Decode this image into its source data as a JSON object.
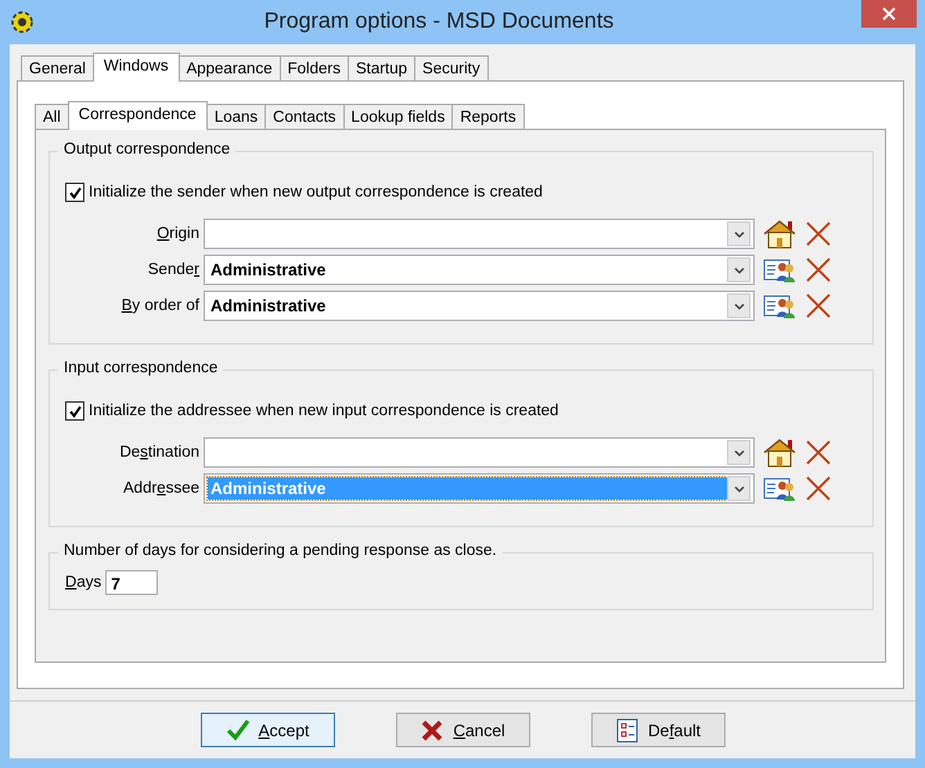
{
  "window": {
    "title": "Program options - MSD Documents"
  },
  "tabs": [
    {
      "label": "General",
      "selected": false
    },
    {
      "label": "Windows",
      "selected": true
    },
    {
      "label": "Appearance",
      "selected": false
    },
    {
      "label": "Folders",
      "selected": false
    },
    {
      "label": "Startup",
      "selected": false
    },
    {
      "label": "Security",
      "selected": false
    }
  ],
  "subtabs": [
    {
      "label": "All",
      "selected": false
    },
    {
      "label": "Correspondence",
      "selected": true
    },
    {
      "label": "Loans",
      "selected": false
    },
    {
      "label": "Contacts",
      "selected": false
    },
    {
      "label": "Lookup fields",
      "selected": false
    },
    {
      "label": "Reports",
      "selected": false
    }
  ],
  "groups": [
    {
      "title": "Output correspondence",
      "checkbox": {
        "label": "Initialize the sender when new output correspondence is created",
        "checked": true
      },
      "fields": [
        {
          "label": {
            "key": "O",
            "post": "rigin"
          },
          "kind": "house",
          "selected": false
        },
        {
          "label": {
            "pre": "Sende",
            "key": "r"
          },
          "value": "Administrative",
          "kind": "people",
          "selected": false
        },
        {
          "label": {
            "key": "B",
            "post": "y order of"
          },
          "value": "Administrative",
          "kind": "people",
          "selected": false
        }
      ]
    },
    {
      "title": "Input correspondence",
      "checkbox": {
        "label": "Initialize the addressee when new input correspondence is created",
        "checked": true
      },
      "fields": [
        {
          "label": {
            "pre": "De",
            "key": "s",
            "post": "tination"
          },
          "kind": "house",
          "selected": false
        },
        {
          "label": {
            "pre": "Addr",
            "key": "e",
            "post": "ssee"
          },
          "value": "Administrative",
          "kind": "people",
          "selected": true
        }
      ]
    }
  ],
  "days": {
    "title": "Number of days for considering a pending response as close.",
    "label": {
      "key": "D",
      "post": "ays"
    },
    "value": "7"
  },
  "buttons": [
    {
      "kind": "accept",
      "label": {
        "key": "A",
        "post": "ccept"
      },
      "selected": true
    },
    {
      "kind": "cancel",
      "label": {
        "key": "C",
        "post": "ancel"
      },
      "selected": false
    },
    {
      "kind": "default",
      "label": {
        "pre": "De",
        "key": "f",
        "post": "ault"
      },
      "selected": false
    }
  ]
}
